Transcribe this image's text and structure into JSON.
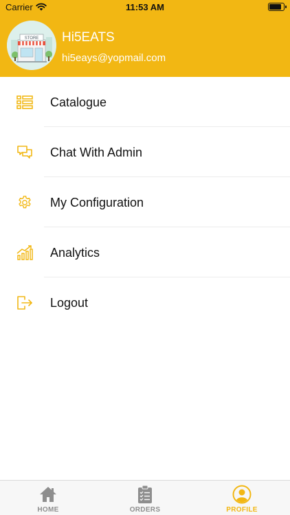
{
  "status_bar": {
    "carrier": "Carrier",
    "time": "11:53 AM"
  },
  "profile": {
    "name": "Hi5EATS",
    "email": "hi5eays@yopmail.com",
    "avatar_sign": "STORE"
  },
  "menu": [
    {
      "label": "Catalogue",
      "icon": "list-icon"
    },
    {
      "label": "Chat With Admin",
      "icon": "chat-icon"
    },
    {
      "label": "My Configuration",
      "icon": "gear-icon"
    },
    {
      "label": "Analytics",
      "icon": "analytics-icon"
    },
    {
      "label": "Logout",
      "icon": "logout-icon"
    }
  ],
  "tabs": [
    {
      "label": "HOME",
      "icon": "home-icon",
      "active": false
    },
    {
      "label": "ORDERS",
      "icon": "clipboard-icon",
      "active": false
    },
    {
      "label": "PROFILE",
      "icon": "user-icon",
      "active": true
    }
  ],
  "colors": {
    "accent": "#F2B713",
    "inactive_tab": "#8E8E8E"
  }
}
